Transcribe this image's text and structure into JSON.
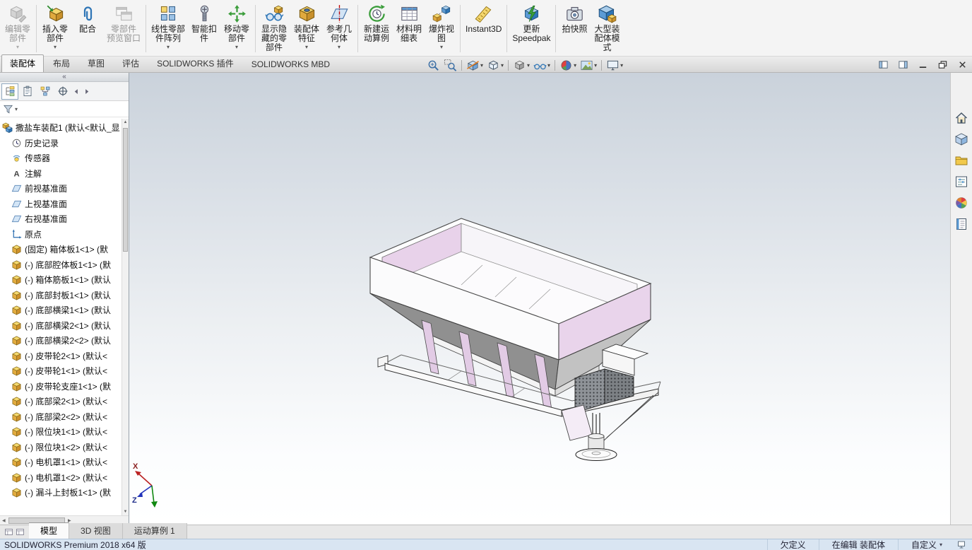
{
  "commandbar": {
    "buttons": [
      {
        "name": "edit-component-button",
        "label": "编辑零\n部件",
        "icon": "i-editcomp",
        "caret": true,
        "disabled": true
      },
      {
        "sep": true
      },
      {
        "name": "insert-components-button",
        "label": "插入零\n部件",
        "icon": "i-insert",
        "caret": true
      },
      {
        "name": "mate-button",
        "label": "配合",
        "icon": "i-mate"
      },
      {
        "name": "component-preview-window-button",
        "label": "零部件\n预览窗口",
        "icon": "i-preview",
        "disabled": true
      },
      {
        "sep": true
      },
      {
        "name": "linear-component-pattern-button",
        "label": "线性零部\n件阵列",
        "icon": "i-pattern",
        "caret": true
      },
      {
        "name": "smart-fasteners-button",
        "label": "智能扣\n件",
        "icon": "i-fastener"
      },
      {
        "name": "move-component-button",
        "label": "移动零\n部件",
        "icon": "i-move",
        "caret": true
      },
      {
        "sep": true
      },
      {
        "name": "show-hidden-components-button",
        "label": "显示隐\n藏的零\n部件",
        "icon": "i-showhide"
      },
      {
        "name": "assembly-features-button",
        "label": "装配体\n特征",
        "icon": "i-asmfeat",
        "caret": true
      },
      {
        "name": "reference-geometry-button",
        "label": "参考几\n何体",
        "icon": "i-refgeom",
        "caret": true
      },
      {
        "sep": true
      },
      {
        "name": "new-motion-study-button",
        "label": "新建运\n动算例",
        "icon": "i-motion"
      },
      {
        "name": "bill-of-materials-button",
        "label": "材料明\n细表",
        "icon": "i-bom"
      },
      {
        "name": "exploded-view-button",
        "label": "爆炸视\n图",
        "icon": "i-explode",
        "caret": true
      },
      {
        "sep": true
      },
      {
        "name": "instant3d-button",
        "label": "Instant3D",
        "icon": "i-instant3d"
      },
      {
        "sep": true
      },
      {
        "name": "update-speedpak-button",
        "label": "更新\nSpeedpak",
        "icon": "i-speedpak"
      },
      {
        "sep": true
      },
      {
        "name": "take-snapshot-button",
        "label": "拍快照",
        "icon": "i-snapshot"
      },
      {
        "name": "large-assembly-mode-button",
        "label": "大型装\n配体模\n式",
        "icon": "i-largeasm"
      }
    ]
  },
  "ribbon_tabs": [
    {
      "name": "tab-assembly",
      "label": "装配体",
      "active": true
    },
    {
      "name": "tab-layout",
      "label": "布局"
    },
    {
      "name": "tab-sketch",
      "label": "草图"
    },
    {
      "name": "tab-evaluate",
      "label": "评估"
    },
    {
      "name": "tab-solidworks-addins",
      "label": "SOLIDWORKS 插件"
    },
    {
      "name": "tab-solidworks-mbd",
      "label": "SOLIDWORKS MBD"
    }
  ],
  "headsup": [
    {
      "name": "zoom-fit-button",
      "icon": "h-zoomfit"
    },
    {
      "name": "zoom-area-button",
      "icon": "h-zoomarea"
    },
    {
      "sep": true
    },
    {
      "name": "section-view-button",
      "icon": "h-section",
      "caret": true
    },
    {
      "name": "view-orientation-button",
      "icon": "h-vieworient",
      "caret": true
    },
    {
      "sep": true
    },
    {
      "name": "display-style-button",
      "icon": "h-display",
      "caret": true
    },
    {
      "name": "hide-show-items-button",
      "icon": "h-hideitems",
      "caret": true
    },
    {
      "sep": true
    },
    {
      "name": "edit-appearance-button",
      "icon": "h-appearance",
      "caret": true
    },
    {
      "name": "apply-scene-button",
      "icon": "h-scene",
      "caret": true
    },
    {
      "sep": true
    },
    {
      "name": "view-settings-button",
      "icon": "h-viewsettings",
      "caret": true
    }
  ],
  "window_buttons": [
    {
      "name": "toggle-left-pane-button",
      "icon": "w-pane1"
    },
    {
      "name": "toggle-right-pane-button",
      "icon": "w-pane2"
    },
    {
      "name": "minimize-button",
      "icon": "w-min"
    },
    {
      "name": "restore-button",
      "icon": "w-restore"
    },
    {
      "name": "close-button",
      "icon": "w-close"
    }
  ],
  "panel": {
    "collapse_glyph": "«",
    "tabs": [
      {
        "name": "featuremanager-tab",
        "icon": "p-tree",
        "active": true
      },
      {
        "name": "propertymanager-tab",
        "icon": "p-clip"
      },
      {
        "name": "configurationmanager-tab",
        "icon": "p-config"
      },
      {
        "name": "dimxpert-tab",
        "icon": "p-dimx"
      },
      {
        "name": "tab-scroll-left",
        "icon": "p-arrow-left",
        "narrow": true
      },
      {
        "name": "tab-scroll-right",
        "icon": "p-arrow-right",
        "narrow": true
      }
    ],
    "tree": {
      "items": [
        {
          "icon": "t-asm",
          "label": "撒盐车装配1 (默认<默认_显",
          "level": 0
        },
        {
          "icon": "t-hist",
          "label": "历史记录",
          "level": 1
        },
        {
          "icon": "t-sensor",
          "label": "传感器",
          "level": 1
        },
        {
          "icon": "t-note",
          "label": "注解",
          "level": 1
        },
        {
          "icon": "t-plane",
          "label": "前视基准面",
          "level": 1
        },
        {
          "icon": "t-plane",
          "label": "上视基准面",
          "level": 1
        },
        {
          "icon": "t-plane",
          "label": "右视基准面",
          "level": 1
        },
        {
          "icon": "t-origin",
          "label": "原点",
          "level": 1
        },
        {
          "icon": "t-part",
          "label": "(固定) 箱体板1<1> (默",
          "level": 1
        },
        {
          "icon": "t-part",
          "label": "(-) 底部腔体板1<1> (默",
          "level": 1
        },
        {
          "icon": "t-part",
          "label": "(-) 箱体筋板1<1> (默认",
          "level": 1
        },
        {
          "icon": "t-part",
          "label": "(-) 底部封板1<1> (默认",
          "level": 1
        },
        {
          "icon": "t-part",
          "label": "(-) 底部横梁1<1> (默认",
          "level": 1
        },
        {
          "icon": "t-part",
          "label": "(-) 底部横梁2<1> (默认",
          "level": 1
        },
        {
          "icon": "t-part",
          "label": "(-) 底部横梁2<2> (默认",
          "level": 1
        },
        {
          "icon": "t-part",
          "label": "(-) 皮带轮2<1> (默认<",
          "level": 1
        },
        {
          "icon": "t-part",
          "label": "(-) 皮带轮1<1> (默认<",
          "level": 1
        },
        {
          "icon": "t-part",
          "label": "(-) 皮带轮支座1<1> (默",
          "level": 1
        },
        {
          "icon": "t-part",
          "label": "(-) 底部梁2<1> (默认<",
          "level": 1
        },
        {
          "icon": "t-part",
          "label": "(-) 底部梁2<2> (默认<",
          "level": 1
        },
        {
          "icon": "t-part",
          "label": "(-) 限位块1<1> (默认<",
          "level": 1
        },
        {
          "icon": "t-part",
          "label": "(-) 限位块1<2> (默认<",
          "level": 1
        },
        {
          "icon": "t-part",
          "label": "(-) 电机罩1<1> (默认<",
          "level": 1
        },
        {
          "icon": "t-part",
          "label": "(-) 电机罩1<2> (默认<",
          "level": 1
        },
        {
          "icon": "t-part",
          "label": "(-) 漏斗上封板1<1> (默",
          "level": 1
        }
      ]
    }
  },
  "viewport": {
    "triad": {
      "x": "X",
      "z": "Z"
    }
  },
  "rightbar": [
    {
      "name": "home-button",
      "icon": "r-home"
    },
    {
      "name": "view-palette-button",
      "icon": "r-grid"
    },
    {
      "name": "design-library-button",
      "icon": "r-folder"
    },
    {
      "name": "custom-properties-button",
      "icon": "r-props"
    },
    {
      "name": "appearances-button",
      "icon": "r-colors"
    },
    {
      "name": "forum-button",
      "icon": "r-notes"
    }
  ],
  "doc_tabs": [
    {
      "name": "tab-model",
      "label": "模型",
      "active": true
    },
    {
      "name": "tab-3d-views",
      "label": "3D 视图"
    },
    {
      "name": "tab-motion-study-1",
      "label": "运动算例 1"
    }
  ],
  "statusbar": {
    "left": "SOLIDWORKS Premium 2018 x64 版",
    "items": [
      {
        "label": "欠定义"
      },
      {
        "label": "在编辑 装配体"
      },
      {
        "label": "自定义",
        "caret": true
      }
    ]
  }
}
